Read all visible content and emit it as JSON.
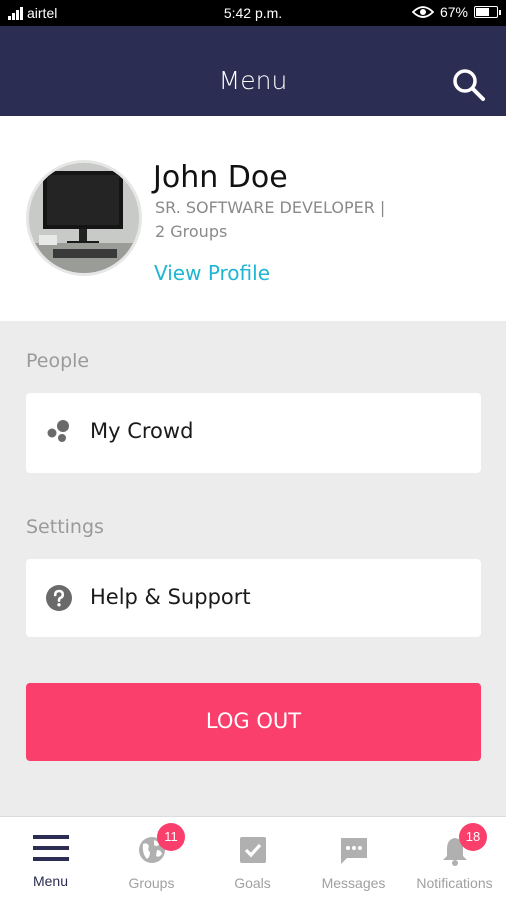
{
  "status_bar": {
    "carrier": "airtel",
    "time": "5:42 p.m.",
    "battery": "67%",
    "battery_level": 0.67
  },
  "app_bar": {
    "title": "Menu",
    "search_icon": "search-icon"
  },
  "profile": {
    "name": "John Doe",
    "role": "SR. SOFTWARE DEVELOPER |",
    "groups": "2 Groups",
    "view_profile": "View Profile"
  },
  "sections": {
    "people": {
      "label": "People",
      "item_label": "My Crowd",
      "item_icon": "crowd-icon"
    },
    "settings": {
      "label": "Settings",
      "item_label": "Help & Support",
      "item_icon": "help-icon"
    }
  },
  "logout": {
    "label": "LOG OUT",
    "color": "#fb3f6c"
  },
  "bottom_nav": {
    "menu": {
      "label": "Menu",
      "icon": "hamburger-icon"
    },
    "groups": {
      "label": "Groups",
      "icon": "globe-icon",
      "badge": "11"
    },
    "goals": {
      "label": "Goals",
      "icon": "checkbox-icon"
    },
    "messages": {
      "label": "Messages",
      "icon": "chat-icon"
    },
    "notifications": {
      "label": "Notifications",
      "icon": "bell-icon",
      "badge": "18"
    }
  },
  "colors": {
    "app_bar": "#2c2d52",
    "accent_link": "#1fb6d3",
    "badge": "#fb3f6c"
  }
}
